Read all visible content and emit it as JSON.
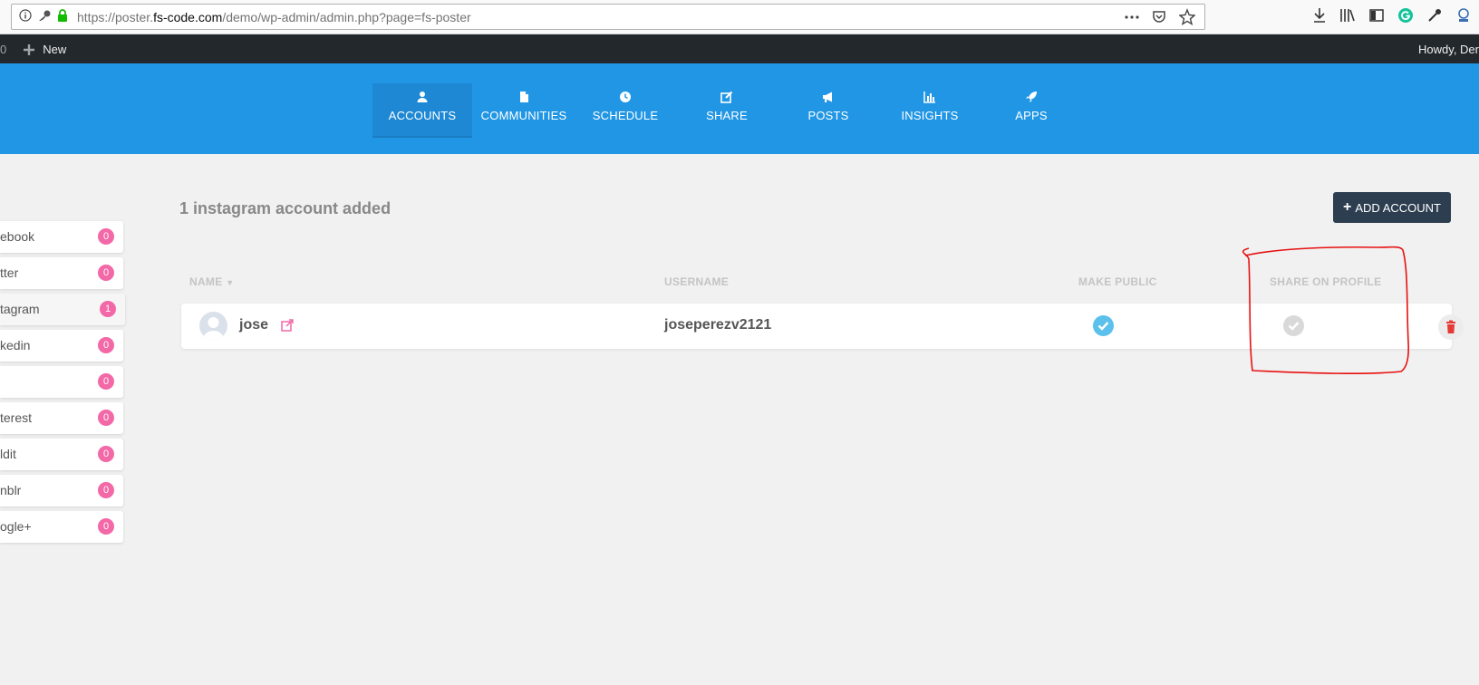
{
  "browser": {
    "url_prefix": "https://poster.",
    "url_host": "fs-code.com",
    "url_path": "/demo/wp-admin/admin.php?page=fs-poster"
  },
  "admin_bar": {
    "left_count": "0",
    "new_label": "New",
    "howdy": "Howdy, Der"
  },
  "nav": {
    "items": [
      {
        "label": "ACCOUNTS",
        "icon": "user-icon"
      },
      {
        "label": "COMMUNITIES",
        "icon": "file-icon"
      },
      {
        "label": "SCHEDULE",
        "icon": "clock-icon"
      },
      {
        "label": "SHARE",
        "icon": "edit-icon"
      },
      {
        "label": "POSTS",
        "icon": "megaphone-icon"
      },
      {
        "label": "INSIGHTS",
        "icon": "bar-chart-icon"
      },
      {
        "label": "APPS",
        "icon": "rocket-icon"
      }
    ]
  },
  "sidebar": {
    "items": [
      {
        "label": "ebook",
        "count": "0"
      },
      {
        "label": "tter",
        "count": "0"
      },
      {
        "label": "tagram",
        "count": "1"
      },
      {
        "label": "kedin",
        "count": "0"
      },
      {
        "label": "",
        "count": "0"
      },
      {
        "label": "terest",
        "count": "0"
      },
      {
        "label": "ldit",
        "count": "0"
      },
      {
        "label": "nblr",
        "count": "0"
      },
      {
        "label": "ogle+",
        "count": "0"
      }
    ]
  },
  "content": {
    "title": "1 instagram account added",
    "add_button": "ADD ACCOUNT",
    "columns": {
      "name": "NAME",
      "username": "USERNAME",
      "make_public": "MAKE PUBLIC",
      "share_on_profile": "SHARE ON PROFILE"
    },
    "account": {
      "name": "jose",
      "username": "joseperezv2121",
      "make_public": true,
      "share_on_profile": false
    }
  },
  "colors": {
    "nav_blue": "#2196e5",
    "badge_pink": "#f368a7",
    "add_button": "#2d3e50",
    "check_blue": "#5bc0eb",
    "delete_red": "#e53935",
    "annotation_red": "#e81010"
  }
}
